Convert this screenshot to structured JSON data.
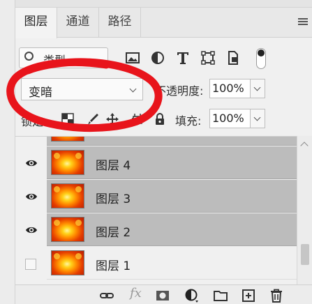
{
  "tabs": [
    {
      "label": "图层",
      "active": true
    },
    {
      "label": "通道",
      "active": false
    },
    {
      "label": "路径",
      "active": false
    }
  ],
  "filter": {
    "kind_label": "类型",
    "icons": [
      "image-filter-icon",
      "adjustment-filter-icon",
      "type-filter-icon",
      "shape-filter-icon",
      "smart-object-filter-icon"
    ]
  },
  "blend": {
    "mode": "变暗",
    "opacity_label": "不透明度:",
    "opacity_value": "100%"
  },
  "lock": {
    "label": "锁定:",
    "fill_label": "填充:",
    "fill_value": "100%"
  },
  "layers": [
    {
      "name": "",
      "visible": true,
      "selected": true
    },
    {
      "name": "图层 4",
      "visible": true,
      "selected": true
    },
    {
      "name": "图层 3",
      "visible": true,
      "selected": true
    },
    {
      "name": "图层 2",
      "visible": true,
      "selected": true
    },
    {
      "name": "图层 1",
      "visible": false,
      "selected": false
    }
  ],
  "bottom_bar": {
    "fx_label": "fx",
    "icons": [
      "link-layers-icon",
      "layer-style-icon",
      "add-mask-icon",
      "new-adjustment-icon",
      "new-group-icon",
      "new-layer-icon",
      "delete-layer-icon"
    ]
  },
  "colors": {
    "annotation_red": "#e8141b",
    "selected_row": "#bcbcbc",
    "panel_bg": "#f0f0f0"
  }
}
